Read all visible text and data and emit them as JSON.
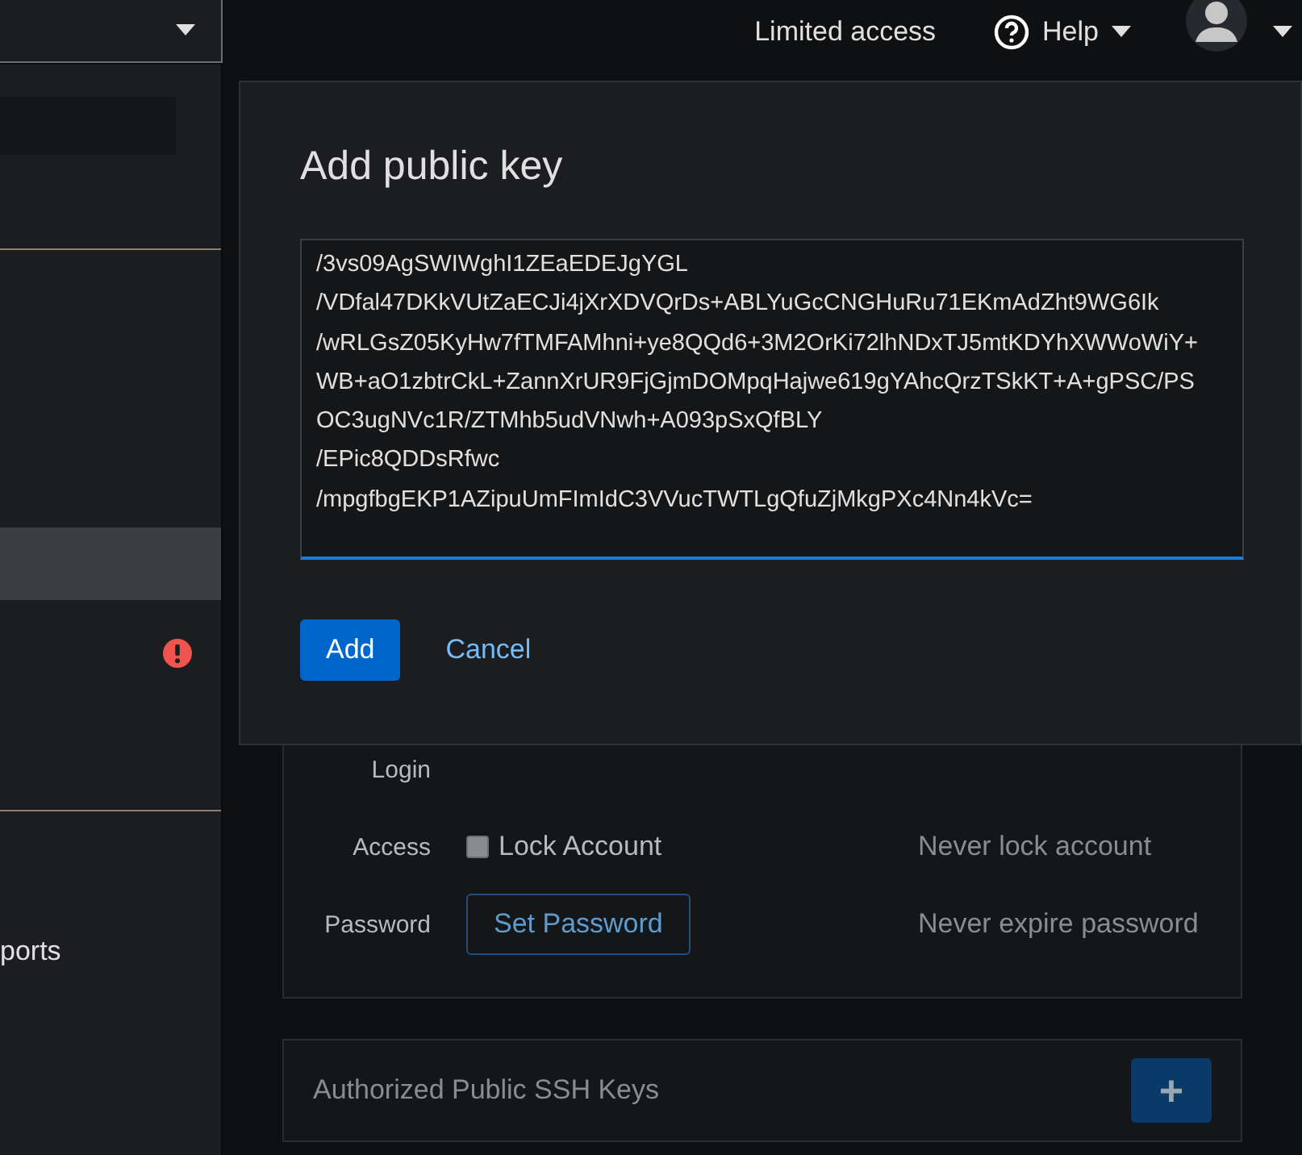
{
  "top_bar": {
    "access_label": "Limited access",
    "help": {
      "label": "Help"
    }
  },
  "sidebar": {
    "items": [
      {
        "kind": "search"
      },
      {
        "kind": "plain",
        "selected": true
      },
      {
        "kind": "alert",
        "selected": false
      },
      {
        "kind": "text",
        "label": "ports",
        "selected": false
      }
    ]
  },
  "account": {
    "rows": [
      {
        "kind": "empty",
        "label": "Login"
      },
      {
        "kind": "checkbox",
        "label": "Access",
        "control": "Lock Account",
        "checked": false,
        "note": "Never lock account"
      },
      {
        "kind": "button",
        "label": "Password",
        "control": "Set Password",
        "note": "Never expire password"
      }
    ]
  },
  "ssh_keys": {
    "title": "Authorized Public SSH Keys",
    "add_button": "+"
  },
  "modal": {
    "title": "Add public key",
    "key_value": "/3vs09AgSWIWghI1ZEaEDEJgYGL\n/VDfal47DKkVUtZaECJi4jXrXDVQrDs+ABLYuGcCNGHuRu71EKmAdZht9WG6Ik\n/wRLGsZ05KyHw7fTMFAMhni+ye8QQd6+3M2OrKi72lhNDxTJ5mtKDYhXWWoWiY+WB+aO1zbtrCkL+ZannXrUR9FjGjmDOMpqHajwe619gYAhcQrzTSkKT+A+gPSC/PSOC3ugNVc1R/ZTMhb5udVNwh+A093pSxQfBLY\n/EPic8QDDsRfwc\n/mpgfbgEKP1AZipuUmFImIdC3VVucTWTLgQfuZjMkgPXc4Nn4kVc=",
    "buttons": [
      {
        "kind": "primary",
        "label": "Add"
      },
      {
        "kind": "link",
        "label": "Cancel"
      }
    ]
  }
}
